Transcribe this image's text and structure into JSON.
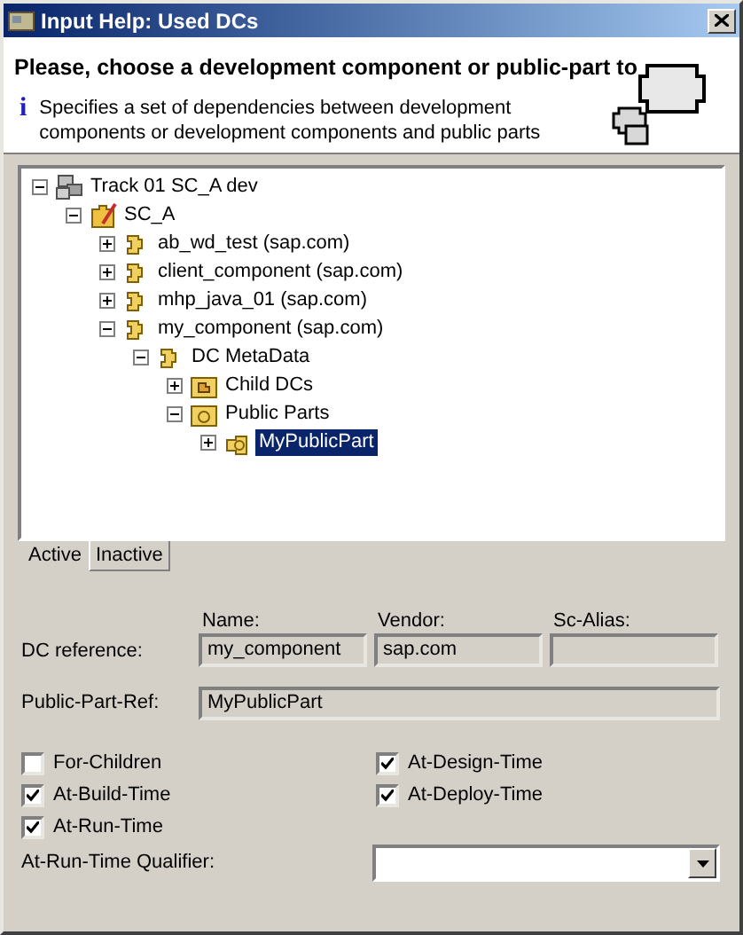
{
  "window": {
    "title": "Input Help: Used DCs"
  },
  "header": {
    "title": "Please, choose a development component or public-part to",
    "info_icon": "i",
    "description": "Specifies a set of dependencies between development components or development components and public parts"
  },
  "tree": [
    {
      "label": "Track 01 SC_A dev",
      "kind": "track",
      "expanded": true,
      "selected": false,
      "children": [
        {
          "label": "SC_A",
          "kind": "sc",
          "expanded": true,
          "selected": false,
          "children": [
            {
              "label": "ab_wd_test (sap.com)",
              "kind": "dc",
              "expanded": false,
              "selected": false
            },
            {
              "label": "client_component (sap.com)",
              "kind": "dc",
              "expanded": false,
              "selected": false
            },
            {
              "label": "mhp_java_01 (sap.com)",
              "kind": "dc",
              "expanded": false,
              "selected": false
            },
            {
              "label": "my_component (sap.com)",
              "kind": "dc",
              "expanded": true,
              "selected": false,
              "children": [
                {
                  "label": "DC MetaData",
                  "kind": "dc",
                  "expanded": true,
                  "selected": false,
                  "children": [
                    {
                      "label": "Child DCs",
                      "kind": "child-folder",
                      "expanded": false,
                      "selected": false
                    },
                    {
                      "label": "Public Parts",
                      "kind": "part-folder",
                      "expanded": true,
                      "selected": false,
                      "children": [
                        {
                          "label": "MyPublicPart",
                          "kind": "part",
                          "expanded": false,
                          "selected": true
                        }
                      ]
                    }
                  ]
                }
              ]
            }
          ]
        }
      ]
    }
  ],
  "tabs": [
    {
      "label": "Active",
      "selected": true
    },
    {
      "label": "Inactive",
      "selected": false
    }
  ],
  "form": {
    "dc_reference_label": "DC reference:",
    "columns": [
      {
        "label": "Name:",
        "value": "my_component"
      },
      {
        "label": "Vendor:",
        "value": "sap.com"
      },
      {
        "label": "Sc-Alias:"
      }
    ],
    "public_part_label": "Public-Part-Ref:",
    "public_part_value": "MyPublicPart",
    "checkboxes": [
      {
        "label": "For-Children",
        "checked": false
      },
      {
        "label": "At-Design-Time",
        "checked": true
      },
      {
        "label": "At-Build-Time",
        "checked": true
      },
      {
        "label": "At-Deploy-Time",
        "checked": true
      },
      {
        "label": "At-Run-Time",
        "checked": true
      }
    ],
    "qualifier_label": "At-Run-Time Qualifier:"
  }
}
